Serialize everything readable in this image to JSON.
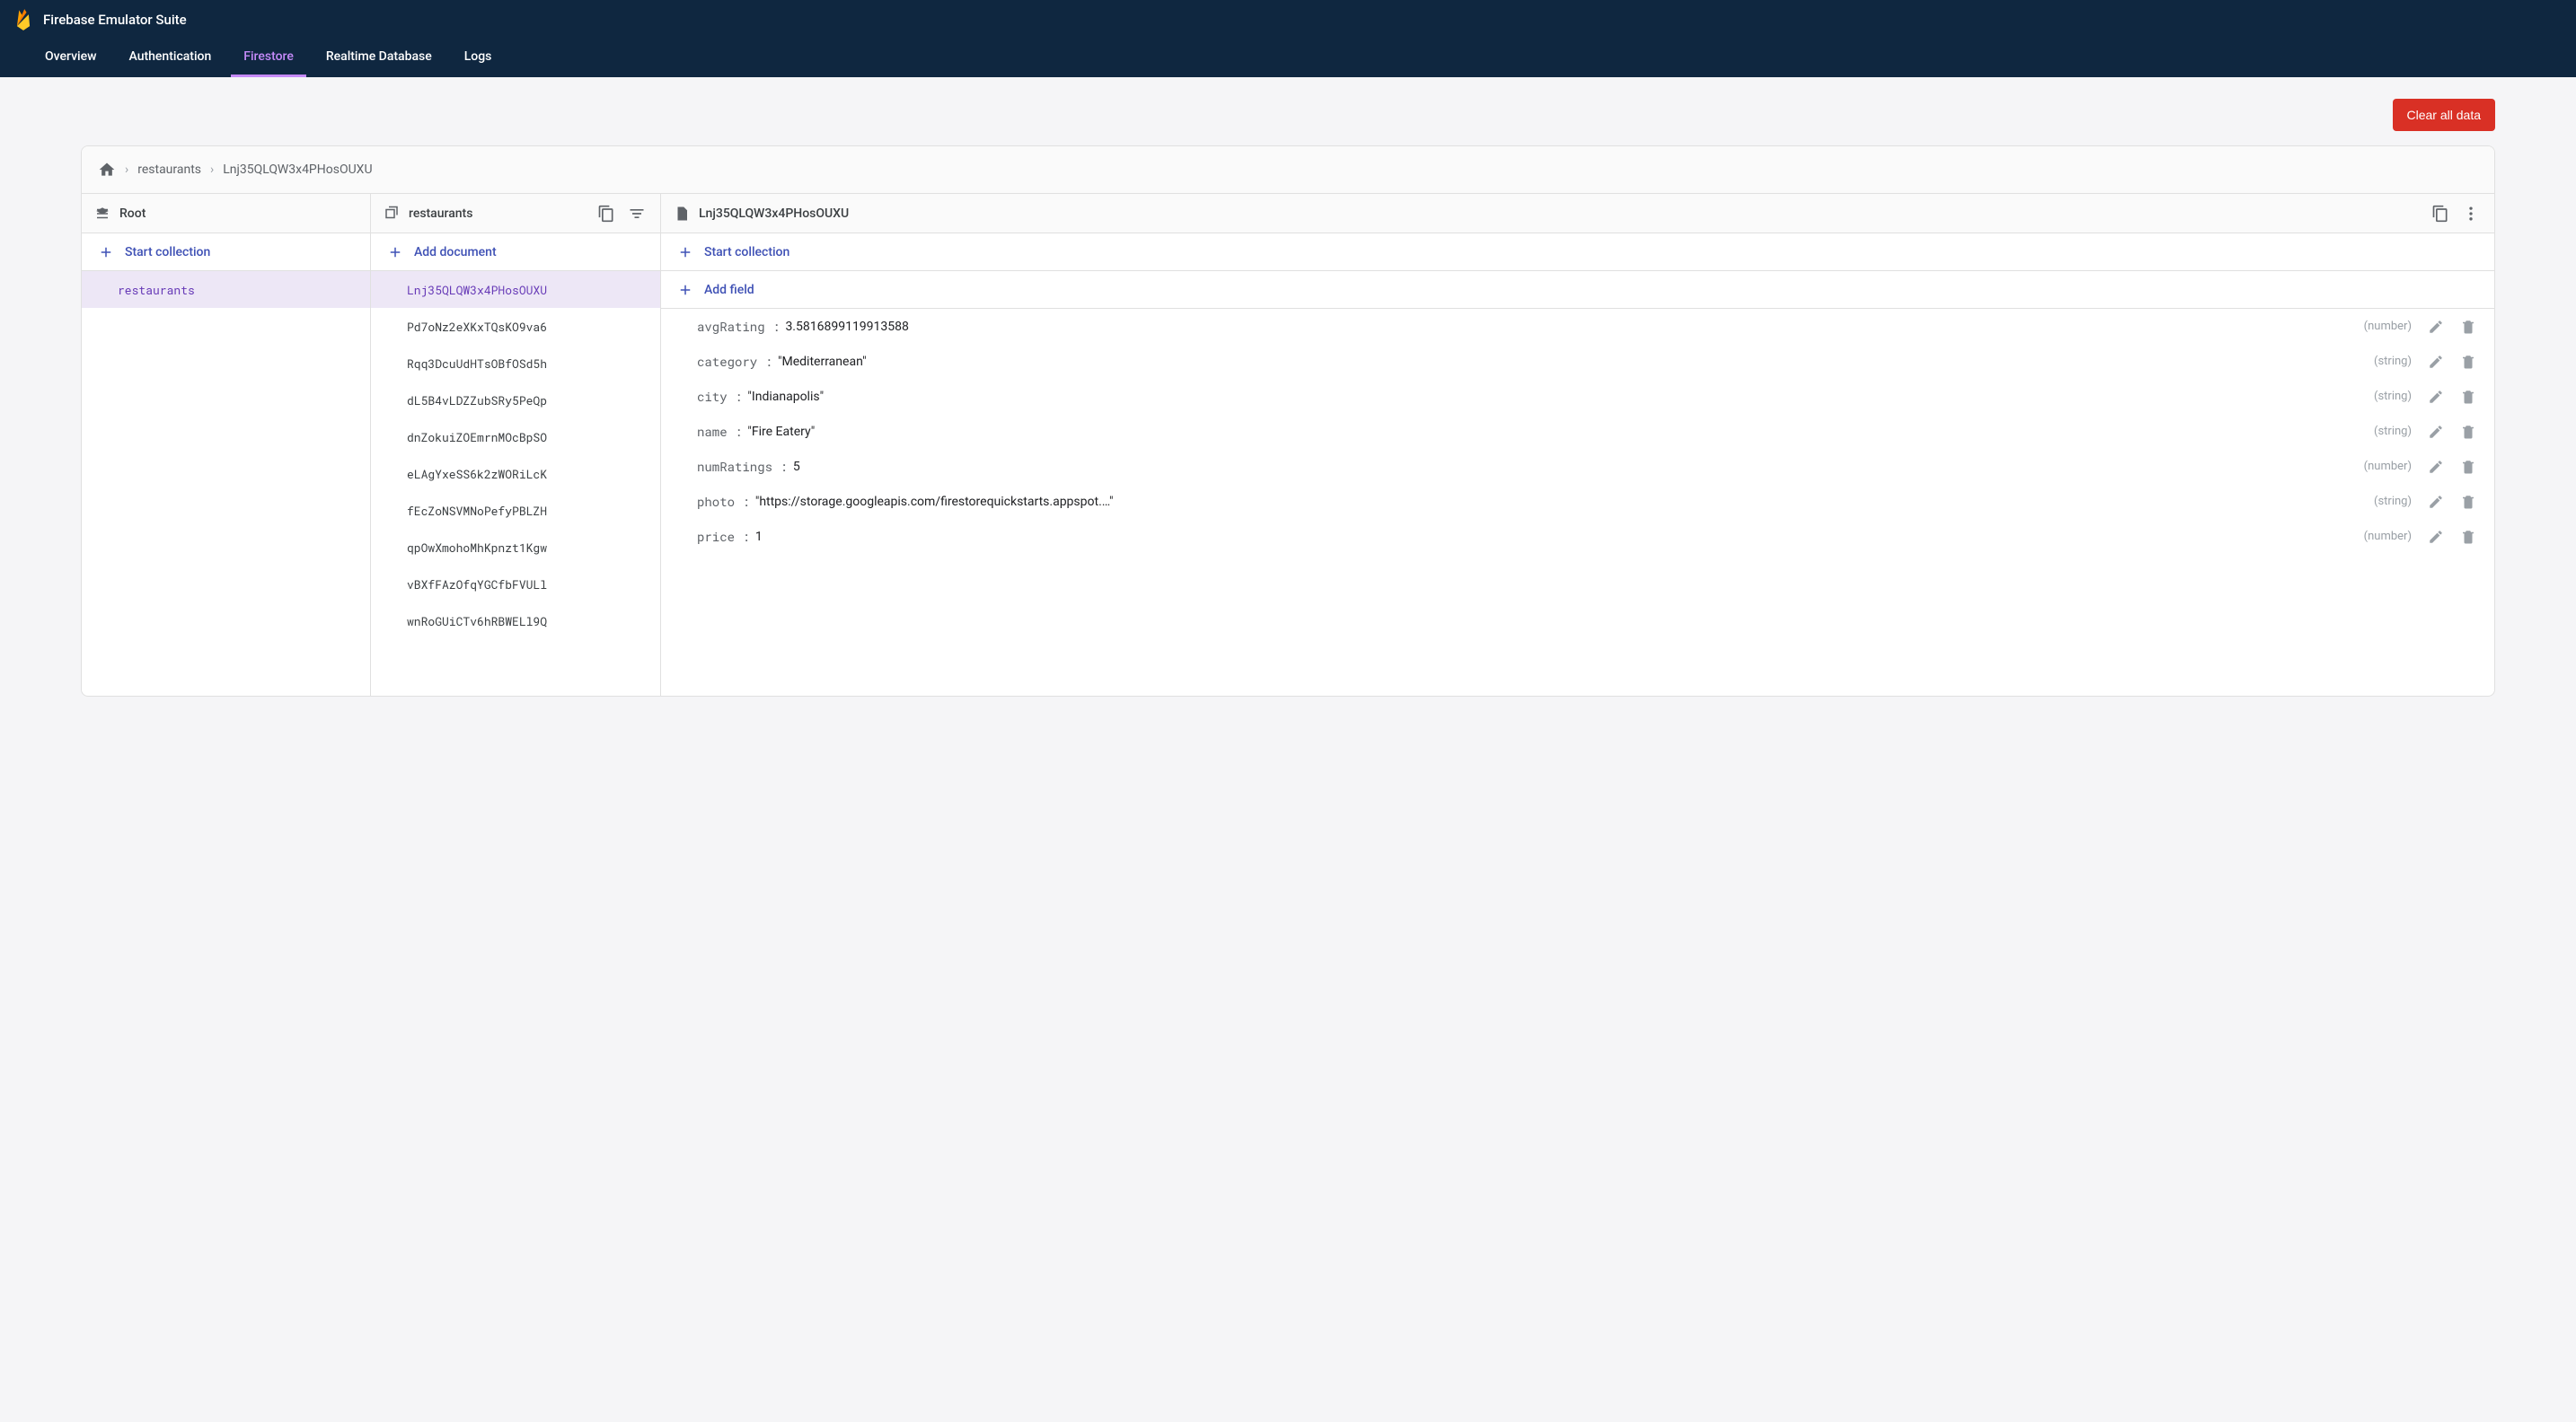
{
  "header": {
    "title": "Firebase Emulator Suite"
  },
  "tabs": [
    {
      "label": "Overview",
      "active": false
    },
    {
      "label": "Authentication",
      "active": false
    },
    {
      "label": "Firestore",
      "active": true
    },
    {
      "label": "Realtime Database",
      "active": false
    },
    {
      "label": "Logs",
      "active": false
    }
  ],
  "actions": {
    "clear_all": "Clear all data"
  },
  "breadcrumb": {
    "collection": "restaurants",
    "document": "Lnj35QLQW3x4PHosOUXU"
  },
  "col_root": {
    "title": "Root",
    "start_collection": "Start collection",
    "items": [
      {
        "id": "restaurants",
        "selected": true
      }
    ]
  },
  "col_collection": {
    "title": "restaurants",
    "add_document": "Add document",
    "items": [
      {
        "id": "Lnj35QLQW3x4PHosOUXU",
        "selected": true
      },
      {
        "id": "Pd7oNz2eXKxTQsKO9va6"
      },
      {
        "id": "Rqq3DcuUdHTsOBfOSd5h"
      },
      {
        "id": "dL5B4vLDZZubSRy5PeQp"
      },
      {
        "id": "dnZokuiZOEmrnMOcBpSO"
      },
      {
        "id": "eLAgYxeSS6k2zWORiLcK"
      },
      {
        "id": "fEcZoNSVMNoPefyPBLZH"
      },
      {
        "id": "qpOwXmohoMhKpnzt1Kgw"
      },
      {
        "id": "vBXfFAzOfqYGCfbFVULl"
      },
      {
        "id": "wnRoGUiCTv6hRBWELl9Q"
      }
    ]
  },
  "col_document": {
    "title": "Lnj35QLQW3x4PHosOUXU",
    "start_collection": "Start collection",
    "add_field": "Add field",
    "fields": [
      {
        "key": "avgRating",
        "value": "3.5816899119913588",
        "type": "number",
        "quoted": false
      },
      {
        "key": "category",
        "value": "Mediterranean",
        "type": "string",
        "quoted": true
      },
      {
        "key": "city",
        "value": "Indianapolis",
        "type": "string",
        "quoted": true
      },
      {
        "key": "name",
        "value": "Fire Eatery",
        "type": "string",
        "quoted": true
      },
      {
        "key": "numRatings",
        "value": "5",
        "type": "number",
        "quoted": false
      },
      {
        "key": "photo",
        "value": "https://storage.googleapis.com/firestorequickstarts.appspot.…",
        "type": "string",
        "quoted": true
      },
      {
        "key": "price",
        "value": "1",
        "type": "number",
        "quoted": false
      }
    ]
  }
}
